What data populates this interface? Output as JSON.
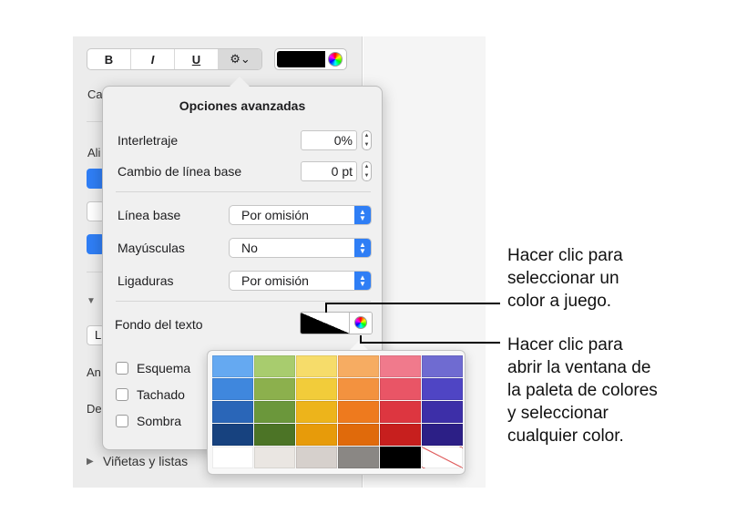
{
  "toolbar": {
    "bold_label": "B",
    "italic_label": "I",
    "underline_label": "U",
    "gear_label": "⚙︎⌄"
  },
  "background_labels": {
    "ca": "Ca",
    "ali": "Ali",
    "l": "L",
    "an": "An",
    "de": "De",
    "bullets": "Viñetas y listas"
  },
  "popover": {
    "title": "Opciones avanzadas",
    "rows": [
      {
        "label": "Interletraje",
        "value": "0%"
      },
      {
        "label": "Cambio de línea base",
        "value": "0 pt"
      }
    ],
    "selects": [
      {
        "label": "Línea base",
        "value": "Por omisión"
      },
      {
        "label": "Mayúsculas",
        "value": "No"
      },
      {
        "label": "Ligaduras",
        "value": "Por omisión"
      }
    ],
    "text_background_label": "Fondo del texto",
    "checkboxes": [
      {
        "label": "Esquema",
        "checked": false
      },
      {
        "label": "Tachado",
        "checked": false
      },
      {
        "label": "Sombra",
        "checked": false
      }
    ]
  },
  "palette": {
    "rows": [
      [
        "#65a9f1",
        "#a8cc6e",
        "#f6dc6a",
        "#f6ac62",
        "#f07a8c",
        "#6f6bd1"
      ],
      [
        "#3f87dd",
        "#8cb04d",
        "#f2cc3a",
        "#f3923f",
        "#e95566",
        "#4f45c4"
      ],
      [
        "#2a66b8",
        "#6b973b",
        "#edb41b",
        "#ee7a1e",
        "#dd3640",
        "#3d2fa8"
      ],
      [
        "#17427f",
        "#4c7426",
        "#e79b0a",
        "#e06a0b",
        "#c71f1e",
        "#2c1f86"
      ],
      [
        "#ffffff",
        "#eae6e2",
        "#d6d0cc",
        "#8a8784",
        "#000000",
        "none"
      ]
    ]
  },
  "callouts": {
    "match_color": [
      "Hacer clic para",
      "seleccionar un",
      "color a juego."
    ],
    "open_palette": [
      "Hacer clic para",
      "abrir la ventana de",
      "la paleta de colores",
      "y seleccionar",
      "cualquier color."
    ]
  }
}
